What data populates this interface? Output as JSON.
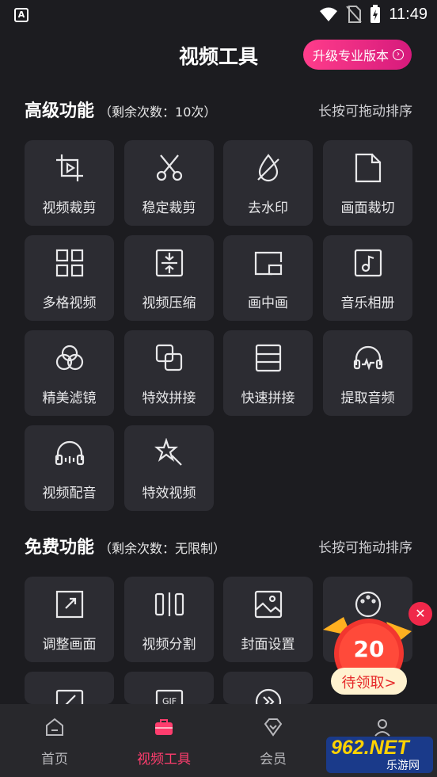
{
  "status_bar": {
    "time": "11:49"
  },
  "header": {
    "title": "视频工具",
    "upgrade_label": "升级专业版本"
  },
  "advanced": {
    "heading": "高级功能",
    "note": "（剩余次数：10次）",
    "sort_hint": "长按可拖动排序"
  },
  "advanced_tools": [
    {
      "label": "视频裁剪",
      "icon": "crop-play-icon"
    },
    {
      "label": "稳定裁剪",
      "icon": "scissors-icon"
    },
    {
      "label": "去水印",
      "icon": "water-drop-icon"
    },
    {
      "label": "画面裁切",
      "icon": "page-corner-icon"
    },
    {
      "label": "多格视频",
      "icon": "grid-icon"
    },
    {
      "label": "视频压缩",
      "icon": "compress-icon"
    },
    {
      "label": "画中画",
      "icon": "picture-in-picture-icon"
    },
    {
      "label": "音乐相册",
      "icon": "music-album-icon"
    },
    {
      "label": "精美滤镜",
      "icon": "filter-circles-icon"
    },
    {
      "label": "特效拼接",
      "icon": "overlap-squares-icon"
    },
    {
      "label": "快速拼接",
      "icon": "stacked-rows-icon"
    },
    {
      "label": "提取音频",
      "icon": "headphones-wave-icon"
    },
    {
      "label": "视频配音",
      "icon": "headphones-icon"
    },
    {
      "label": "特效视频",
      "icon": "magic-star-icon"
    }
  ],
  "free": {
    "heading": "免费功能",
    "note": "（剩余次数：无限制）",
    "sort_hint": "长按可拖动排序"
  },
  "free_tools": [
    {
      "label": "调整画面",
      "icon": "resize-icon"
    },
    {
      "label": "视频分割",
      "icon": "split-icon"
    },
    {
      "label": "封面设置",
      "icon": "cover-image-icon"
    },
    {
      "label": "",
      "icon": "palette-icon"
    },
    {
      "label": "",
      "icon": "edit-frame-icon"
    },
    {
      "label": "",
      "icon": "gif-icon"
    },
    {
      "label": "",
      "icon": "fast-forward-icon"
    }
  ],
  "promo": {
    "number": "20",
    "label": "待领取>"
  },
  "tabs": [
    {
      "label": "首页",
      "icon": "home-icon",
      "active": false
    },
    {
      "label": "视频工具",
      "icon": "toolbox-icon",
      "active": true
    },
    {
      "label": "会员",
      "icon": "diamond-icon",
      "active": false
    },
    {
      "label": "",
      "icon": "profile-icon",
      "active": false
    }
  ],
  "watermark": {
    "brand": "962.NET",
    "sub": "乐游网"
  },
  "colors": {
    "background": "#1c1c20",
    "tile": "#2c2c32",
    "accent": "#ff3d6e",
    "upgrade": "#e91e7c"
  }
}
